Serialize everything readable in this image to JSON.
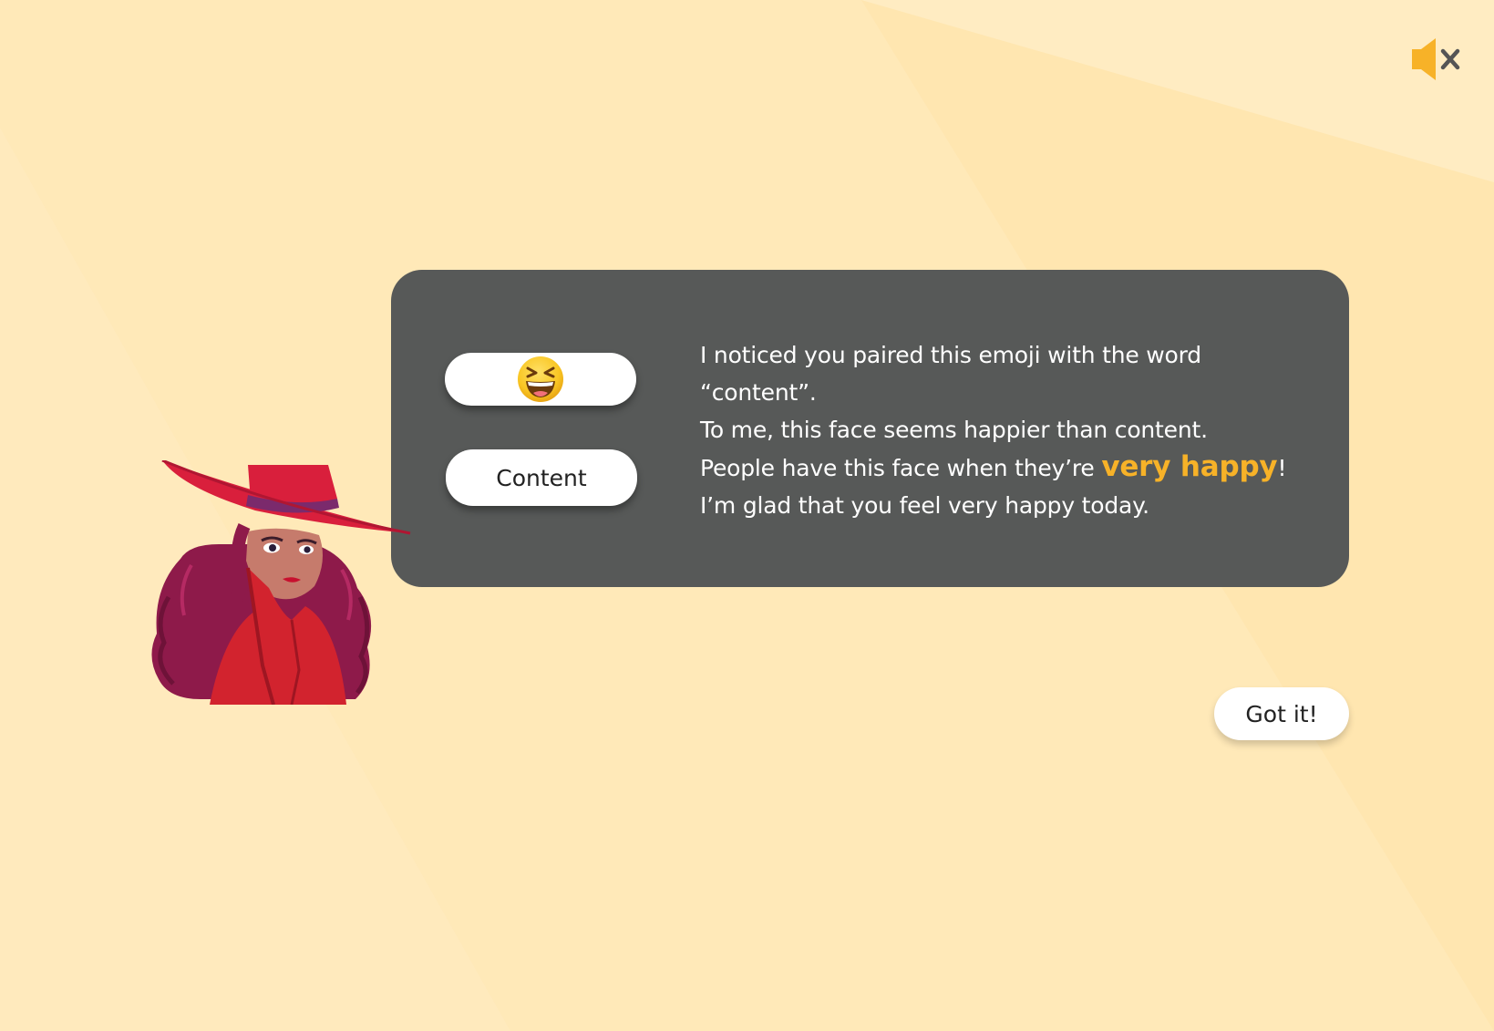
{
  "colors": {
    "background": "#FFE6B0",
    "background_stripe": "#FFEBC0",
    "bubble": "#575958",
    "accent": "#F7B228",
    "mute_icon": "#F7B228",
    "close_x": "#555555"
  },
  "controls": {
    "mute_icon": "speaker-muted-icon"
  },
  "pairing": {
    "emoji": "😆",
    "word_label": "Content"
  },
  "message": {
    "line1": "I noticed you paired this emoji with the word “content”.",
    "line2": "To me, this face seems happier than content.",
    "line3_prefix": "People have this face when they’re ",
    "line3_highlight": "very happy",
    "line3_suffix": "!",
    "line4": "I’m glad that you feel very happy today."
  },
  "character": {
    "name": "character-avatar-icon"
  },
  "actions": {
    "got_it_label": "Got it!"
  }
}
